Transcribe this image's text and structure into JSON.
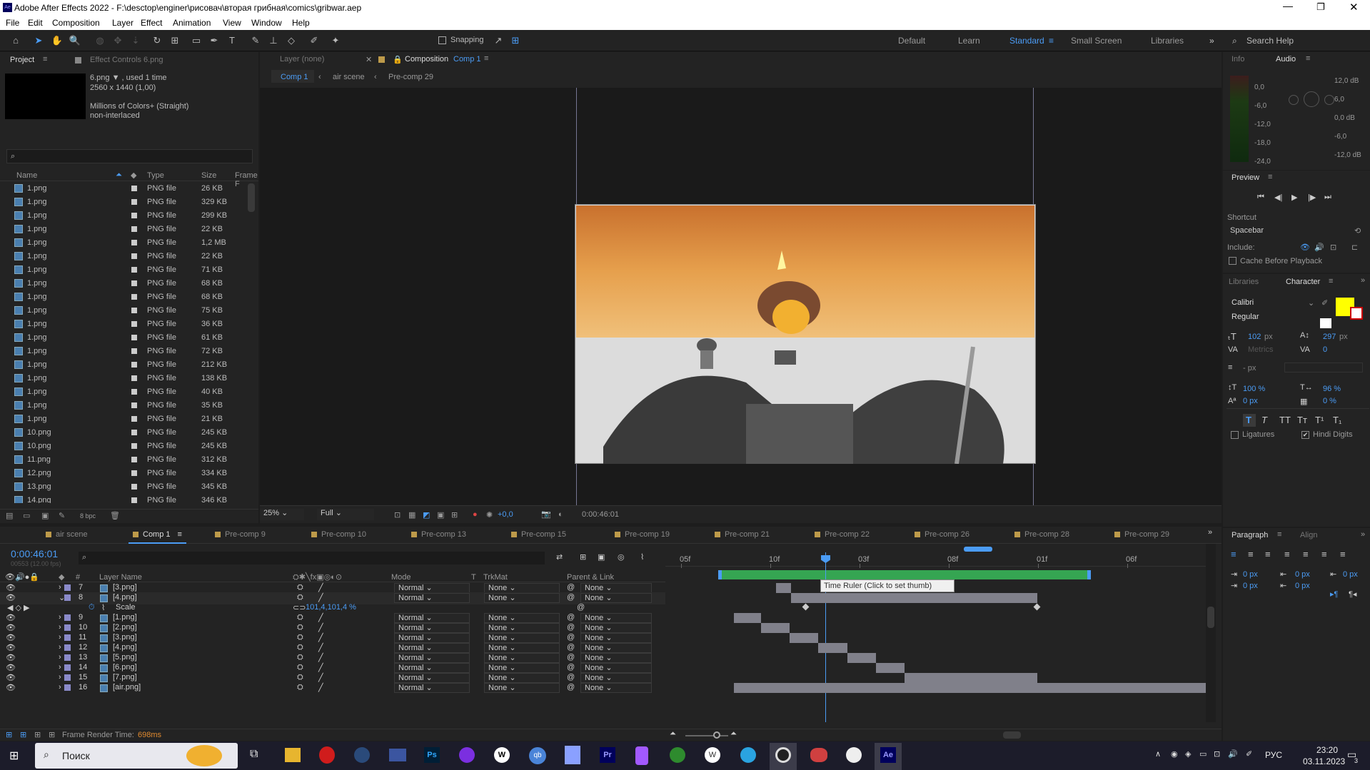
{
  "window": {
    "title": "Adobe After Effects 2022 - F:\\desctop\\enginer\\рисовач\\вторая грибная\\comics\\gribwar.aep"
  },
  "menu": [
    "File",
    "Edit",
    "Composition",
    "Layer",
    "Effect",
    "Animation",
    "View",
    "Window",
    "Help"
  ],
  "toolbar": {
    "snapping": "Snapping",
    "workspaces": [
      "Default",
      "Learn",
      "Standard",
      "Small Screen",
      "Libraries"
    ],
    "active_workspace": "Standard",
    "search_placeholder": "Search Help"
  },
  "project": {
    "tab": "Project",
    "effect_tab": "Effect Controls 6.png",
    "file_name": "6.png ▼ , used 1 time",
    "dims": "2560 x 1440 (1,00)",
    "colors": "Millions of Colors+ (Straight)",
    "interlace": "non-interlaced",
    "search_placeholder": "",
    "columns": [
      "Name",
      "Type",
      "Size",
      "Frame F"
    ],
    "bpc": "8 bpc",
    "files": [
      [
        "1.png",
        "PNG file",
        "26 KB"
      ],
      [
        "1.png",
        "PNG file",
        "329 KB"
      ],
      [
        "1.png",
        "PNG file",
        "299 KB"
      ],
      [
        "1.png",
        "PNG file",
        "22 KB"
      ],
      [
        "1.png",
        "PNG file",
        "1,2 MB"
      ],
      [
        "1.png",
        "PNG file",
        "22 KB"
      ],
      [
        "1.png",
        "PNG file",
        "71 KB"
      ],
      [
        "1.png",
        "PNG file",
        "68 KB"
      ],
      [
        "1.png",
        "PNG file",
        "68 KB"
      ],
      [
        "1.png",
        "PNG file",
        "75 KB"
      ],
      [
        "1.png",
        "PNG file",
        "36 KB"
      ],
      [
        "1.png",
        "PNG file",
        "61 KB"
      ],
      [
        "1.png",
        "PNG file",
        "72 KB"
      ],
      [
        "1.png",
        "PNG file",
        "212 KB"
      ],
      [
        "1.png",
        "PNG file",
        "138 KB"
      ],
      [
        "1.png",
        "PNG file",
        "40 KB"
      ],
      [
        "1.png",
        "PNG file",
        "35 KB"
      ],
      [
        "1.png",
        "PNG file",
        "21 KB"
      ],
      [
        "10.png",
        "PNG file",
        "245 KB"
      ],
      [
        "10.png",
        "PNG file",
        "245 KB"
      ],
      [
        "11.png",
        "PNG file",
        "312 KB"
      ],
      [
        "12.png",
        "PNG file",
        "334 KB"
      ],
      [
        "13.png",
        "PNG file",
        "345 KB"
      ],
      [
        "14.png",
        "PNG file",
        "346 KB"
      ]
    ]
  },
  "viewer": {
    "layer_tab": "Layer  (none)",
    "comp_tab": "Composition",
    "comp_name": "Comp 1",
    "breadcrumbs": [
      "Comp 1",
      "air scene",
      "Pre-comp 29"
    ],
    "zoom": "25%",
    "resolution": "Full",
    "exposure": "+0,0",
    "timecode": "0:00:46:01"
  },
  "info": {
    "info_tab": "Info",
    "audio_tab": "Audio",
    "db_left": [
      "0,0",
      "-6,0",
      "-12,0",
      "-18,0",
      "-24,0"
    ],
    "db_right": [
      "12,0 dB",
      "6,0",
      "0,0 dB",
      "-6,0",
      "-12,0 dB"
    ]
  },
  "preview": {
    "title": "Preview",
    "shortcut_label": "Shortcut",
    "shortcut": "Spacebar",
    "include_label": "Include:",
    "cache": "Cache Before Playback"
  },
  "character": {
    "libraries_tab": "Libraries",
    "tab": "Character",
    "font": "Calibri",
    "style": "Regular",
    "size": "102",
    "size_unit": "px",
    "leading": "297",
    "leading_unit": "px",
    "kerning": "Metrics",
    "tracking": "0",
    "stroke_unit": "- px",
    "vscale": "100 %",
    "hscale": "96 %",
    "baseline": "0 px",
    "tsume": "0 %",
    "ligatures": "Ligatures",
    "hindi": "Hindi Digits",
    "fill_color": "#ffff00",
    "styles": [
      "T",
      "T",
      "TT",
      "Tт",
      "T¹",
      "T₁"
    ]
  },
  "paragraph": {
    "tab": "Paragraph",
    "align_tab": "Align",
    "indents": [
      "0 px",
      "0 px",
      "0 px",
      "0 px",
      "0 px"
    ]
  },
  "timeline": {
    "tabs": [
      "air scene",
      "Comp 1",
      "Pre-comp 9",
      "Pre-comp 10",
      "Pre-comp 13",
      "Pre-comp 15",
      "Pre-comp 19",
      "Pre-comp 21",
      "Pre-comp 22",
      "Pre-comp 26",
      "Pre-comp 28",
      "Pre-comp 29"
    ],
    "active_tab": "Comp 1",
    "timecode": "0:00:46:01",
    "frames": "00553 (12.00 fps)",
    "headers": [
      "#",
      "Layer Name",
      "Mode",
      "T",
      "TrkMat",
      "Parent & Link"
    ],
    "ruler": [
      "05f",
      "10f",
      "03f",
      "08f",
      "01f",
      "06f"
    ],
    "tooltip": "Time Ruler (Click to set thumb)",
    "render_time_label": "Frame Render Time:",
    "render_time": "698ms",
    "scale_label": "Scale",
    "scale_value": "101,4,101,4 %",
    "layers": [
      {
        "n": "7",
        "name": "[3.png]"
      },
      {
        "n": "8",
        "name": "[4.png]"
      },
      {
        "n": "9",
        "name": "[1.png]"
      },
      {
        "n": "10",
        "name": "[2.png]"
      },
      {
        "n": "11",
        "name": "[3.png]"
      },
      {
        "n": "12",
        "name": "[4.png]"
      },
      {
        "n": "13",
        "name": "[5.png]"
      },
      {
        "n": "14",
        "name": "[6.png]"
      },
      {
        "n": "15",
        "name": "[7.png]"
      },
      {
        "n": "16",
        "name": "[air.png]"
      }
    ],
    "mode": "Normal",
    "trkmat": "None",
    "parent": "None"
  },
  "taskbar": {
    "search": "Поиск",
    "lang": "РУС",
    "time": "23:20",
    "date": "03.11.2023",
    "notif": "3"
  }
}
